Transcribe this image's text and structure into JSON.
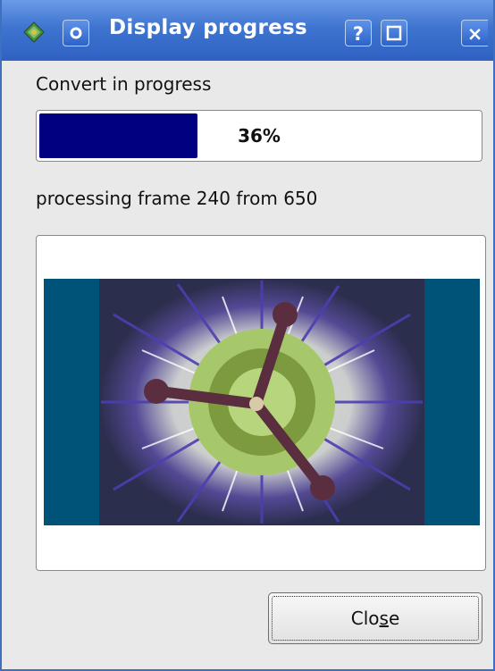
{
  "window": {
    "title": "Display progress",
    "title_left_button_icon": "circle-icon",
    "title_help_label": "?",
    "title_maximize_icon": "maximize-icon",
    "title_close_label": "×"
  },
  "progress": {
    "label": "Convert in progress",
    "percent": 0.36,
    "percent_text": "36%",
    "bar_color": "#000080"
  },
  "status": {
    "text": "processing frame 240 from 650"
  },
  "close_button": {
    "label_pre": "Clo",
    "label_mnemonic": "s",
    "label_post": "e"
  },
  "colors": {
    "titlebar": "#3f74d0",
    "preview_background": "#005378"
  }
}
